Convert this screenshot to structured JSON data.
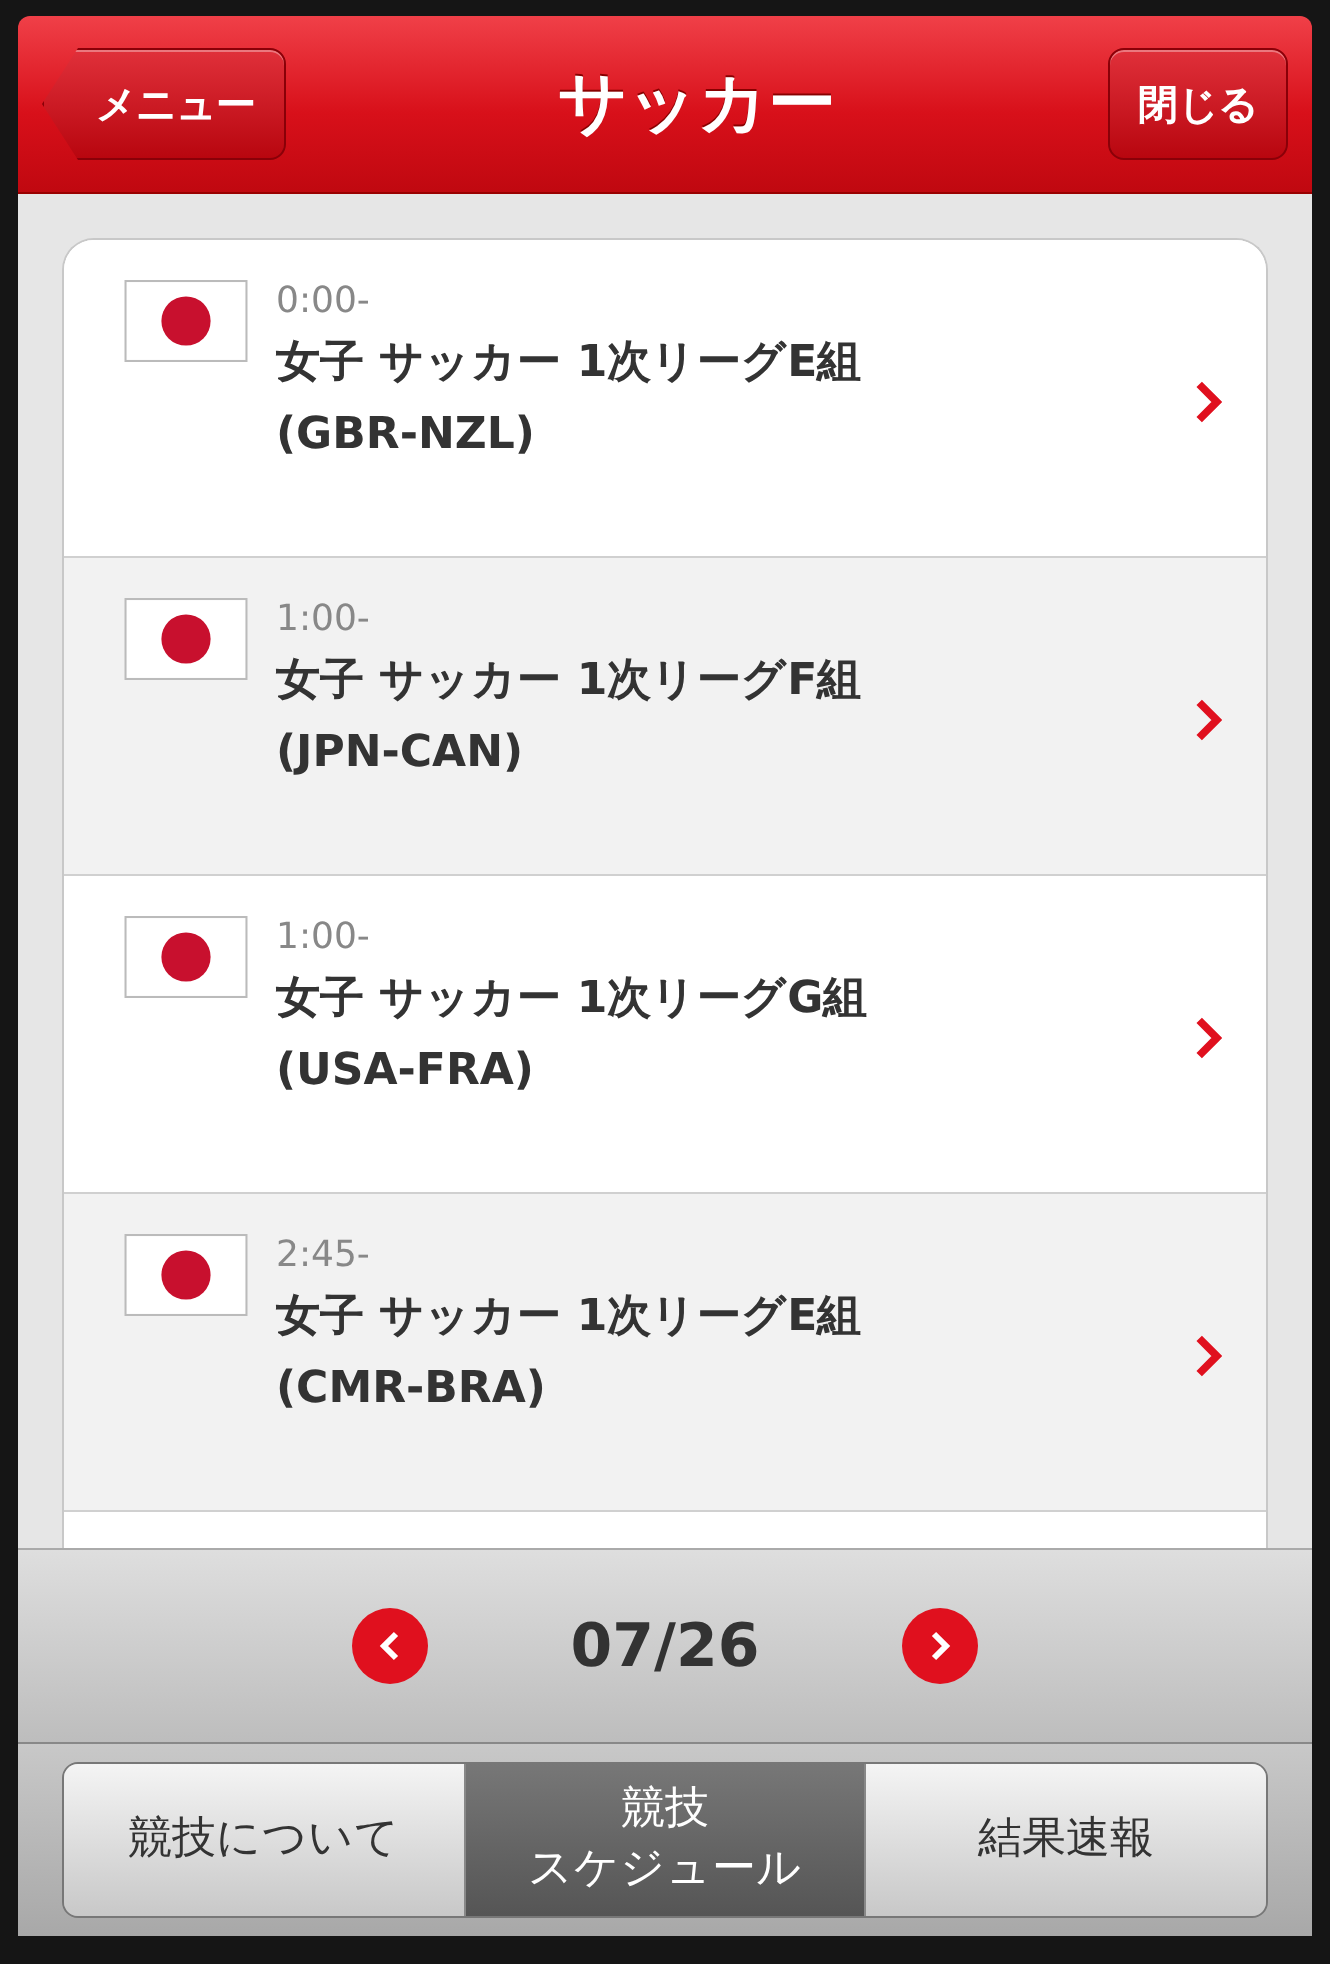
{
  "header": {
    "back_button": "メニュー",
    "title": "サッカー",
    "close_button": "閉じる"
  },
  "events": [
    {
      "time": "0:00-",
      "title": "女子 サッカー 1次リーグE組",
      "match": "(GBR-NZL)"
    },
    {
      "time": "1:00-",
      "title": "女子 サッカー 1次リーグF組",
      "match": "(JPN-CAN)"
    },
    {
      "time": "1:00-",
      "title": "女子 サッカー 1次リーグG組",
      "match": "(USA-FRA)"
    },
    {
      "time": "2:45-",
      "title": "女子 サッカー 1次リーグE組",
      "match": "(CMR-BRA)"
    }
  ],
  "pager": {
    "date": "07/26"
  },
  "tabs": [
    {
      "lines": [
        "競技について"
      ],
      "selected": false
    },
    {
      "lines": [
        "競技",
        "スケジュール"
      ],
      "selected": true
    },
    {
      "lines": [
        "結果速報"
      ],
      "selected": false
    }
  ]
}
